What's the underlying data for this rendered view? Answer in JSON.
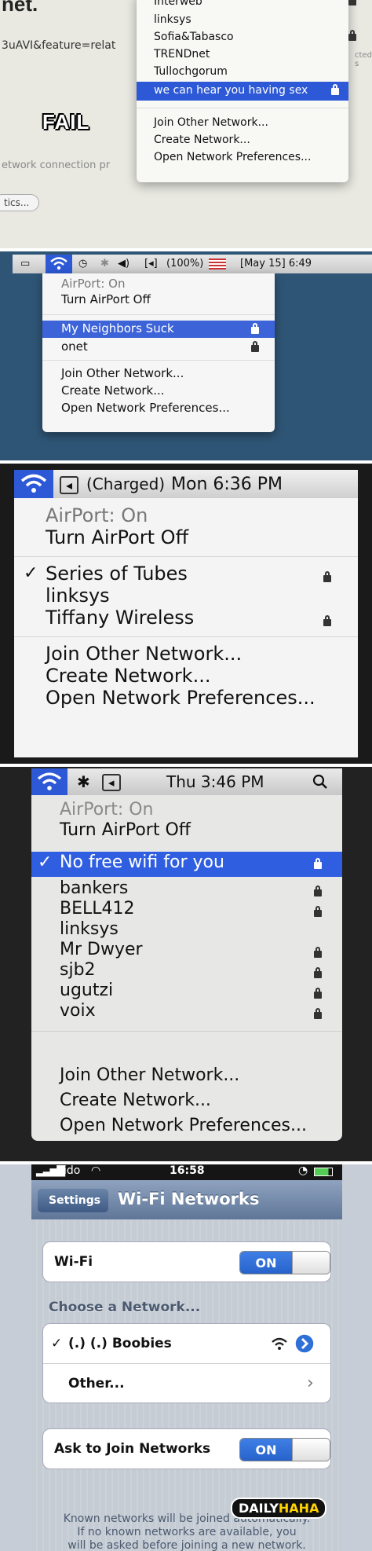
{
  "panel1": {
    "page_title_fragment": "net.",
    "url_fragment": "3uAVI&feature=relat",
    "fail_caption": "FAIL",
    "connection_text": "etwork connection pr",
    "button_fragment": "tics...",
    "side_text": "cted s",
    "menu": {
      "networks": [
        "Interweb",
        "linksys",
        "Sofia&Tabasco",
        "TRENDnet",
        "Tullochgorum"
      ],
      "selected": "we can hear you having sex",
      "actions": [
        "Join Other Network...",
        "Create Network...",
        "Open Network Preferences..."
      ]
    }
  },
  "panel2": {
    "menubar": {
      "battery": "(100%)",
      "date_time": "[May 15] 6:49"
    },
    "status": "AirPort: On",
    "toggle": "Turn AirPort Off",
    "selected": "My Neighbors Suck",
    "networks": [
      "onet"
    ],
    "actions": [
      "Join Other Network...",
      "Create Network...",
      "Open Network Preferences..."
    ]
  },
  "panel3": {
    "menubar": {
      "battery": "(Charged)",
      "date_time": "Mon 6:36 PM"
    },
    "status": "AirPort: On",
    "toggle": "Turn AirPort Off",
    "check_mark": "✓",
    "networks": [
      "Series of Tubes",
      "linksys",
      "Tiffany Wireless"
    ],
    "actions": [
      "Join Other Network...",
      "Create Network...",
      "Open Network Preferences..."
    ]
  },
  "panel4": {
    "menubar": {
      "date_time": "Thu 3:46 PM"
    },
    "status": "AirPort: On",
    "toggle": "Turn AirPort Off",
    "check_mark": "✓",
    "selected": "No free wifi for you",
    "networks": [
      "bankers",
      "BELL412",
      "linksys",
      "Mr Dwyer",
      "sjb2",
      "ugutzi",
      "voix"
    ],
    "actions": [
      "Join Other Network...",
      "Create Network...",
      "Open Network Preferences..."
    ]
  },
  "panel5": {
    "status": {
      "carrier": "Fido",
      "time": "16:58"
    },
    "back_label": "Settings",
    "title": "Wi-Fi Networks",
    "wifi_label": "Wi-Fi",
    "toggle_on": "ON",
    "section_header": "Choose a Network...",
    "check_mark": "✓",
    "network": "(.) (.) Boobies",
    "other_label": "Other...",
    "ask_label": "Ask to Join Networks",
    "footer_lines": [
      "Known networks will be joined automatically.",
      "If no known networks are available, you",
      "will be asked before joining a new network."
    ],
    "logo_prefix": "DAILY",
    "logo_suffix": "HAHA"
  }
}
